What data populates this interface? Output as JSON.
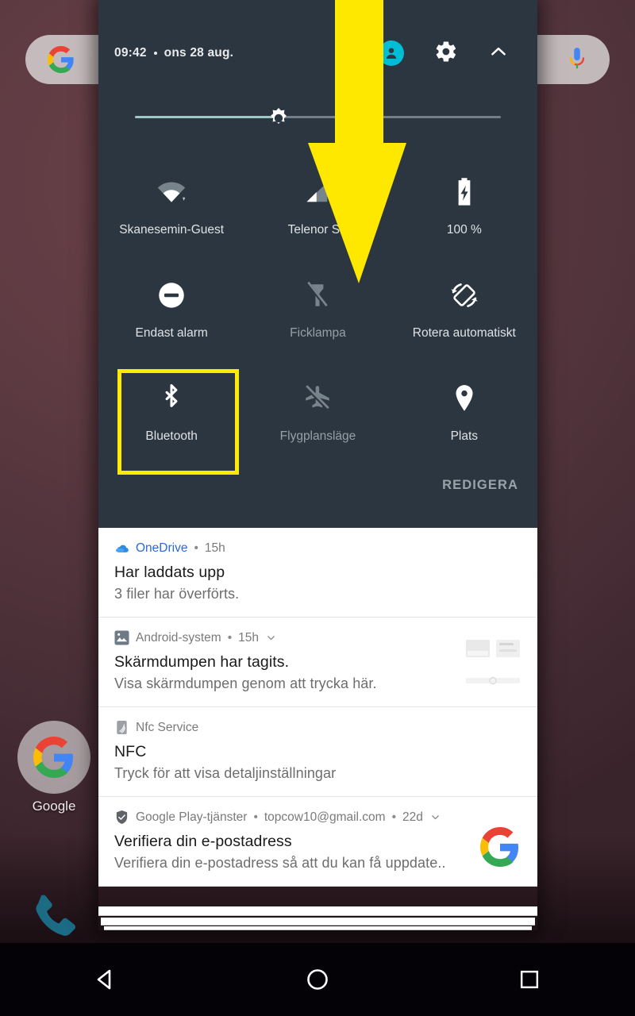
{
  "statusbar": {
    "time": "09:42",
    "separator": "•",
    "date": "ons 28 aug.",
    "avatar_icon": "user-avatar-icon",
    "settings_icon": "gear-icon",
    "collapse_icon": "chevron-up-icon"
  },
  "brightness": {
    "icon": "brightness-sun-icon",
    "value_percent": 38
  },
  "tiles": [
    [
      {
        "label": "Skanesemin-Guest",
        "icon": "wifi-icon",
        "state": "on"
      },
      {
        "label": "Telenor SE",
        "icon": "mobile-signal-icon",
        "state": "on"
      },
      {
        "label": "100 %",
        "icon": "battery-charging-icon",
        "state": "on"
      }
    ],
    [
      {
        "label": "Endast alarm",
        "icon": "do-not-disturb-icon",
        "state": "on"
      },
      {
        "label": "Ficklampa",
        "icon": "flashlight-off-icon",
        "state": "off"
      },
      {
        "label": "Rotera automatiskt",
        "icon": "auto-rotate-icon",
        "state": "on"
      }
    ],
    [
      {
        "label": "Bluetooth",
        "icon": "bluetooth-icon",
        "state": "on",
        "highlighted": true
      },
      {
        "label": "Flygplansläge",
        "icon": "airplane-mode-off-icon",
        "state": "off"
      },
      {
        "label": "Plats",
        "icon": "location-pin-icon",
        "state": "on"
      }
    ]
  ],
  "edit_button": {
    "label": "REDIGERA"
  },
  "notifications": [
    {
      "app": "OneDrive",
      "app_icon": "onedrive-cloud-icon",
      "app_color": "blue",
      "time": "15h",
      "expandable": false,
      "title": "Har laddats upp",
      "body": "3 filer har överförts.",
      "thumb": "none"
    },
    {
      "app": "Android-system",
      "app_icon": "image-icon",
      "app_color": "grey",
      "time": "15h",
      "expandable": true,
      "title": "Skärmdumpen har tagits.",
      "body": "Visa skärmdumpen genom att trycka här.",
      "thumb": "screenshot-preview"
    },
    {
      "app": "Nfc Service",
      "app_icon": "nfc-icon",
      "app_color": "grey",
      "time": "",
      "expandable": false,
      "title": "NFC",
      "body": "Tryck för att visa detaljinställningar",
      "thumb": "none"
    },
    {
      "app": "Google Play-tjänster",
      "app_icon": "shield-icon",
      "app_color": "grey",
      "account": "topcow10@gmail.com",
      "time": "22d",
      "expandable": true,
      "title": "Verifiera din e-postadress",
      "body": "Verifiera din e-postadress så att du kan få uppdate..",
      "thumb": "google-g-icon"
    }
  ],
  "homescreen": {
    "search_widget": {
      "leading_icon": "google-g-icon",
      "mic_icon": "google-mic-icon"
    },
    "folder": {
      "label": "Google",
      "icon": "google-folder-icon"
    },
    "dock": {
      "phone_icon": "phone-icon"
    }
  },
  "overlay": {
    "arrow": {
      "name": "swipe-down-arrow",
      "color": "#ffe800",
      "direction": "down"
    },
    "highlight_color": "#ffeb00"
  },
  "navbar": {
    "back": "back-triangle-icon",
    "home": "home-circle-icon",
    "recents": "recents-square-icon"
  }
}
